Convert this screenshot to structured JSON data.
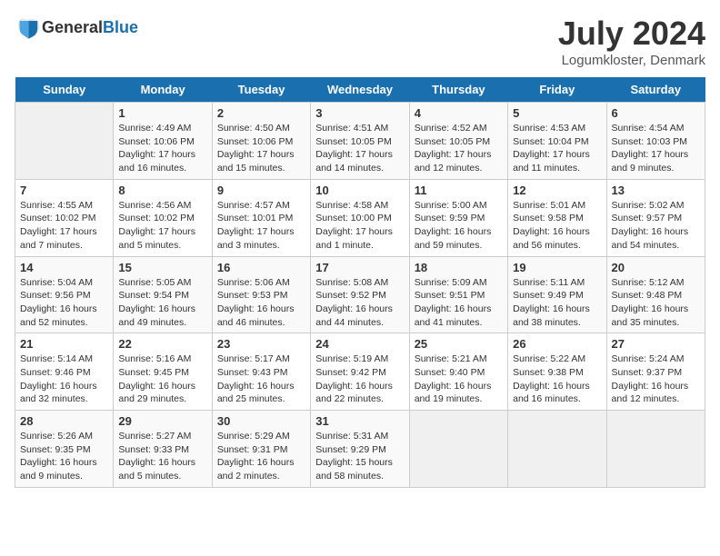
{
  "header": {
    "logo_general": "General",
    "logo_blue": "Blue",
    "title": "July 2024",
    "subtitle": "Logumkloster, Denmark"
  },
  "days_of_week": [
    "Sunday",
    "Monday",
    "Tuesday",
    "Wednesday",
    "Thursday",
    "Friday",
    "Saturday"
  ],
  "weeks": [
    [
      {
        "day": "",
        "info": ""
      },
      {
        "day": "1",
        "info": "Sunrise: 4:49 AM\nSunset: 10:06 PM\nDaylight: 17 hours\nand 16 minutes."
      },
      {
        "day": "2",
        "info": "Sunrise: 4:50 AM\nSunset: 10:06 PM\nDaylight: 17 hours\nand 15 minutes."
      },
      {
        "day": "3",
        "info": "Sunrise: 4:51 AM\nSunset: 10:05 PM\nDaylight: 17 hours\nand 14 minutes."
      },
      {
        "day": "4",
        "info": "Sunrise: 4:52 AM\nSunset: 10:05 PM\nDaylight: 17 hours\nand 12 minutes."
      },
      {
        "day": "5",
        "info": "Sunrise: 4:53 AM\nSunset: 10:04 PM\nDaylight: 17 hours\nand 11 minutes."
      },
      {
        "day": "6",
        "info": "Sunrise: 4:54 AM\nSunset: 10:03 PM\nDaylight: 17 hours\nand 9 minutes."
      }
    ],
    [
      {
        "day": "7",
        "info": "Sunrise: 4:55 AM\nSunset: 10:02 PM\nDaylight: 17 hours\nand 7 minutes."
      },
      {
        "day": "8",
        "info": "Sunrise: 4:56 AM\nSunset: 10:02 PM\nDaylight: 17 hours\nand 5 minutes."
      },
      {
        "day": "9",
        "info": "Sunrise: 4:57 AM\nSunset: 10:01 PM\nDaylight: 17 hours\nand 3 minutes."
      },
      {
        "day": "10",
        "info": "Sunrise: 4:58 AM\nSunset: 10:00 PM\nDaylight: 17 hours\nand 1 minute."
      },
      {
        "day": "11",
        "info": "Sunrise: 5:00 AM\nSunset: 9:59 PM\nDaylight: 16 hours\nand 59 minutes."
      },
      {
        "day": "12",
        "info": "Sunrise: 5:01 AM\nSunset: 9:58 PM\nDaylight: 16 hours\nand 56 minutes."
      },
      {
        "day": "13",
        "info": "Sunrise: 5:02 AM\nSunset: 9:57 PM\nDaylight: 16 hours\nand 54 minutes."
      }
    ],
    [
      {
        "day": "14",
        "info": "Sunrise: 5:04 AM\nSunset: 9:56 PM\nDaylight: 16 hours\nand 52 minutes."
      },
      {
        "day": "15",
        "info": "Sunrise: 5:05 AM\nSunset: 9:54 PM\nDaylight: 16 hours\nand 49 minutes."
      },
      {
        "day": "16",
        "info": "Sunrise: 5:06 AM\nSunset: 9:53 PM\nDaylight: 16 hours\nand 46 minutes."
      },
      {
        "day": "17",
        "info": "Sunrise: 5:08 AM\nSunset: 9:52 PM\nDaylight: 16 hours\nand 44 minutes."
      },
      {
        "day": "18",
        "info": "Sunrise: 5:09 AM\nSunset: 9:51 PM\nDaylight: 16 hours\nand 41 minutes."
      },
      {
        "day": "19",
        "info": "Sunrise: 5:11 AM\nSunset: 9:49 PM\nDaylight: 16 hours\nand 38 minutes."
      },
      {
        "day": "20",
        "info": "Sunrise: 5:12 AM\nSunset: 9:48 PM\nDaylight: 16 hours\nand 35 minutes."
      }
    ],
    [
      {
        "day": "21",
        "info": "Sunrise: 5:14 AM\nSunset: 9:46 PM\nDaylight: 16 hours\nand 32 minutes."
      },
      {
        "day": "22",
        "info": "Sunrise: 5:16 AM\nSunset: 9:45 PM\nDaylight: 16 hours\nand 29 minutes."
      },
      {
        "day": "23",
        "info": "Sunrise: 5:17 AM\nSunset: 9:43 PM\nDaylight: 16 hours\nand 25 minutes."
      },
      {
        "day": "24",
        "info": "Sunrise: 5:19 AM\nSunset: 9:42 PM\nDaylight: 16 hours\nand 22 minutes."
      },
      {
        "day": "25",
        "info": "Sunrise: 5:21 AM\nSunset: 9:40 PM\nDaylight: 16 hours\nand 19 minutes."
      },
      {
        "day": "26",
        "info": "Sunrise: 5:22 AM\nSunset: 9:38 PM\nDaylight: 16 hours\nand 16 minutes."
      },
      {
        "day": "27",
        "info": "Sunrise: 5:24 AM\nSunset: 9:37 PM\nDaylight: 16 hours\nand 12 minutes."
      }
    ],
    [
      {
        "day": "28",
        "info": "Sunrise: 5:26 AM\nSunset: 9:35 PM\nDaylight: 16 hours\nand 9 minutes."
      },
      {
        "day": "29",
        "info": "Sunrise: 5:27 AM\nSunset: 9:33 PM\nDaylight: 16 hours\nand 5 minutes."
      },
      {
        "day": "30",
        "info": "Sunrise: 5:29 AM\nSunset: 9:31 PM\nDaylight: 16 hours\nand 2 minutes."
      },
      {
        "day": "31",
        "info": "Sunrise: 5:31 AM\nSunset: 9:29 PM\nDaylight: 15 hours\nand 58 minutes."
      },
      {
        "day": "",
        "info": ""
      },
      {
        "day": "",
        "info": ""
      },
      {
        "day": "",
        "info": ""
      }
    ]
  ]
}
